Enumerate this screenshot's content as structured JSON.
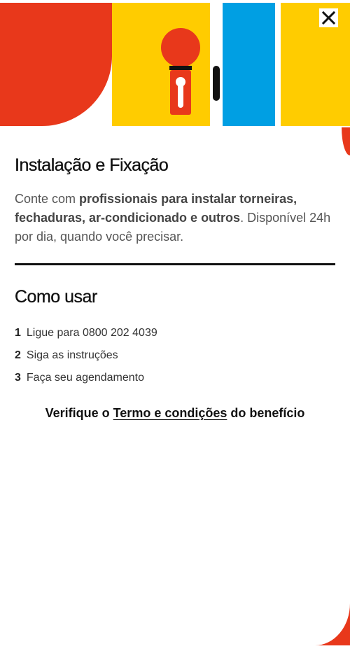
{
  "hero": {
    "colors": {
      "red": "#e8381b",
      "yellow": "#ffcc00",
      "blue": "#009fe3",
      "black": "#111111"
    },
    "illustration": "door-lock-illustration"
  },
  "close_button": {
    "icon": "close-icon",
    "label": "✕"
  },
  "service": {
    "title": "Instalação e Fixação",
    "description_intro": "Conte com ",
    "description_bold": "profissionais para instalar torneiras, fechaduras, ar-condicionado e outros",
    "description_outro": ". Disponível 24h por dia, quando você precisar."
  },
  "how_to_use": {
    "title": "Como usar",
    "steps": [
      {
        "number": "1",
        "text": "Ligue para 0800 202 4039"
      },
      {
        "number": "2",
        "text": "Siga as instruções"
      },
      {
        "number": "3",
        "text": "Faça seu agendamento"
      }
    ]
  },
  "terms": {
    "prefix": "Verifique o ",
    "link_label": "Termo e condições",
    "suffix": " do benefício"
  }
}
